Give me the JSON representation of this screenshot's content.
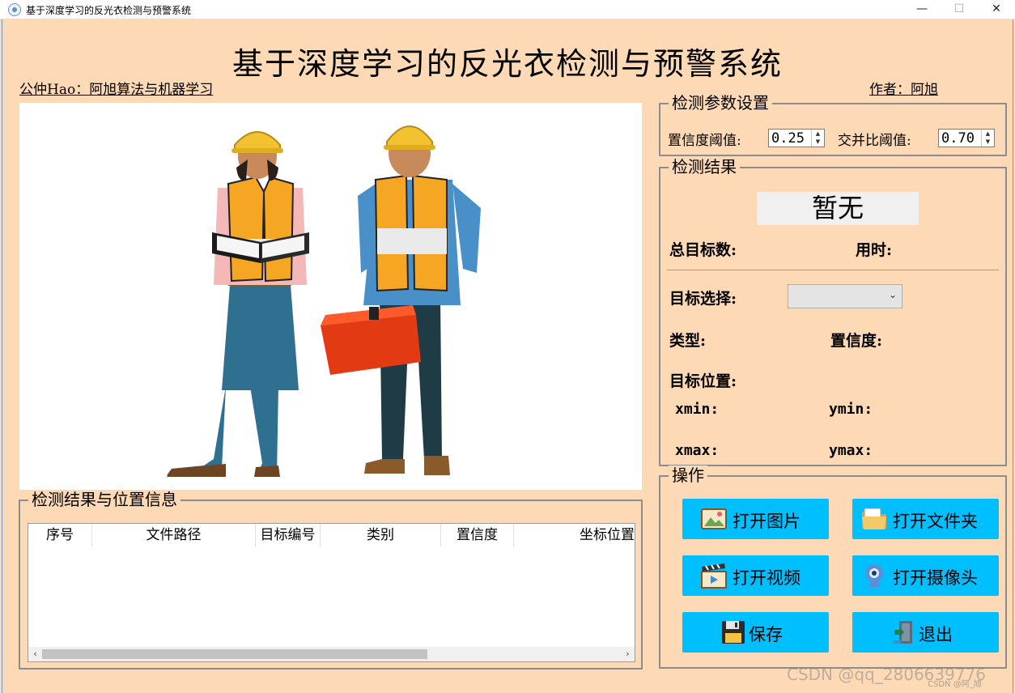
{
  "window": {
    "title": "基于深度学习的反光衣检测与预警系统",
    "min_glyph": "—",
    "max_glyph": "☐",
    "close_glyph": "✕"
  },
  "header": {
    "title": "基于深度学习的反光衣检测与预警系统",
    "left_note": "公仲Hao：阿旭算法与机器学习",
    "author": "作者：阿旭"
  },
  "table_group": {
    "title": "检测结果与位置信息",
    "columns": [
      "序号",
      "文件路径",
      "目标编号",
      "类别",
      "置信度",
      "坐标位置"
    ],
    "rows": [],
    "scroll_left": "‹",
    "scroll_right": "›"
  },
  "params": {
    "title": "检测参数设置",
    "conf_label": "置信度阈值:",
    "conf_value": "0.25",
    "iou_label": "交并比阈值:",
    "iou_value": "0.70"
  },
  "detect": {
    "title": "检测结果",
    "status": "暂无",
    "total_label": "总目标数:",
    "time_label": "用时:",
    "target_select_label": "目标选择:",
    "target_select_value": "",
    "type_label": "类型:",
    "conf_label": "置信度:",
    "pos_label": "目标位置:",
    "xmin_label": "xmin:",
    "ymin_label": "ymin:",
    "xmax_label": "xmax:",
    "ymax_label": "ymax:"
  },
  "ops": {
    "title": "操作",
    "open_image": "打开图片",
    "open_folder": "打开文件夹",
    "open_video": "打开视频",
    "open_camera": "打开摄像头",
    "save": "保存",
    "exit": "退出"
  },
  "icons": {
    "open_image": "image-icon",
    "open_folder": "folder-icon",
    "open_video": "video-clapper-icon",
    "open_camera": "webcam-icon",
    "save": "floppy-disk-icon",
    "exit": "exit-door-icon"
  },
  "colors": {
    "background": "#fdd9b5",
    "button": "#00bfff",
    "vest": "#f5a623",
    "helmet": "#f2c230"
  },
  "watermark": "CSDN @qq_2806639776",
  "watermark_small": "CSDN @阿_旭"
}
